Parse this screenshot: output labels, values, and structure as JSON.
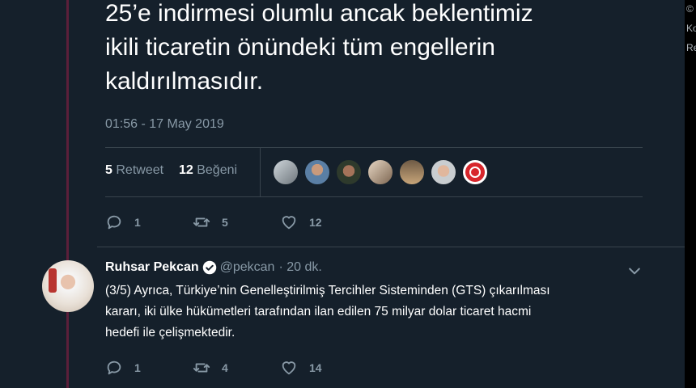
{
  "main_tweet": {
    "text_lines": [
      "25’e indirmesi olumlu ancak beklentimiz",
      "ikili ticaretin önündeki tüm engellerin",
      "kaldırılmasıdır."
    ],
    "timestamp": "01:56 - 17 May 2019",
    "retweet_count": "5",
    "retweet_label": "Retweet",
    "like_count": "12",
    "like_label": "Beğeni",
    "actions": {
      "reply": "1",
      "retweet": "5",
      "like": "12"
    }
  },
  "reply_tweet": {
    "name": "Ruhsar Pekcan",
    "handle": "@pekcan",
    "time": "· 20 dk.",
    "text_lines": [
      "(3/5) Ayrıca, Türkiye’nin Genelleştirilmiş Tercihler Sisteminden (GTS) çıkarılması",
      "kararı, iki ülke hükümetleri tarafından ilan edilen 75 milyar dolar ticaret hacmi",
      "hedefi ile çelişmektedir."
    ],
    "actions": {
      "reply": "1",
      "retweet": "4",
      "like": "14"
    }
  },
  "sidebar_fragments": [
    "©",
    "Ko",
    "Re"
  ]
}
